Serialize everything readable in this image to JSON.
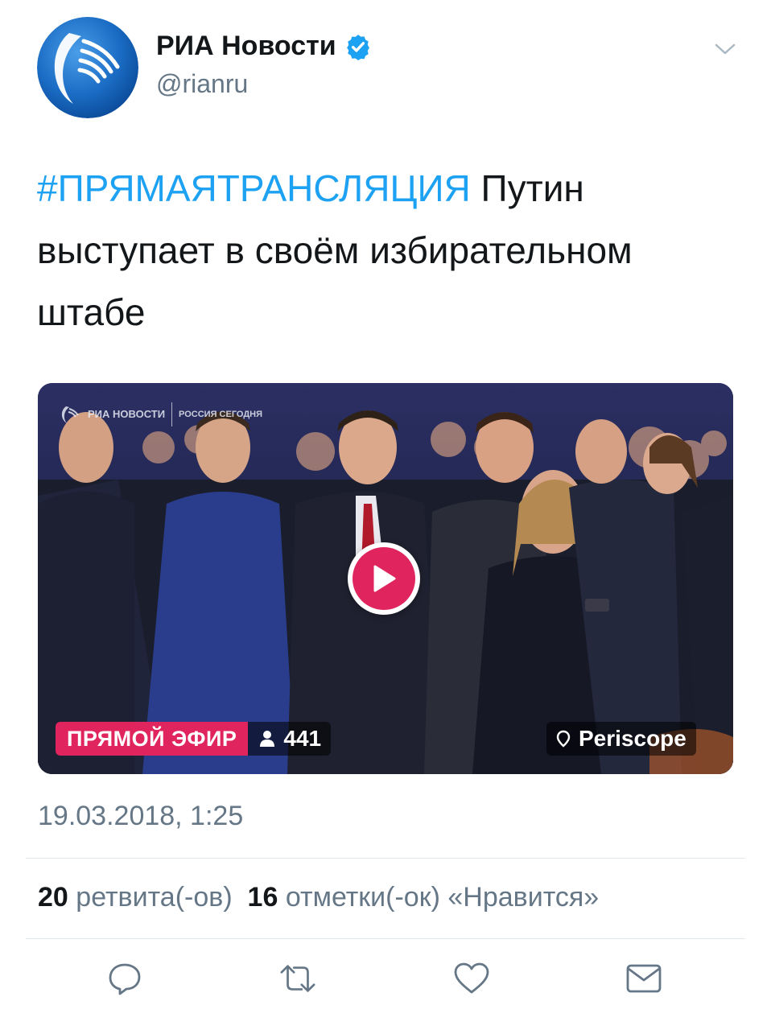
{
  "author": {
    "name": "РИА Новости",
    "handle": "@rianru",
    "verified": true,
    "avatar_icon": "ria-novosti-logo-icon"
  },
  "tweet": {
    "hashtag": "#ПРЯМАЯТРАНСЛЯЦИЯ",
    "text": " Путин выступает в своём избирательном штабе"
  },
  "media": {
    "watermark_left": "РИА НОВОСТИ",
    "watermark_right": "РОССИЯ СЕГОДНЯ",
    "live_label": "ПРЯМОЙ ЭФИР",
    "viewer_count": "441",
    "provider": "Periscope",
    "live_color": "#e0245e"
  },
  "timestamp": "19.03.2018, 1:25",
  "stats": {
    "retweets_count": "20",
    "retweets_label": "ретвита(-ов)",
    "likes_count": "16",
    "likes_label": "отметки(-ок) «Нравится»"
  },
  "colors": {
    "link": "#1da1f2",
    "secondary_text": "#657786",
    "primary_text": "#14171a"
  },
  "actions": [
    "reply-icon",
    "retweet-icon",
    "like-icon",
    "direct-message-icon"
  ]
}
